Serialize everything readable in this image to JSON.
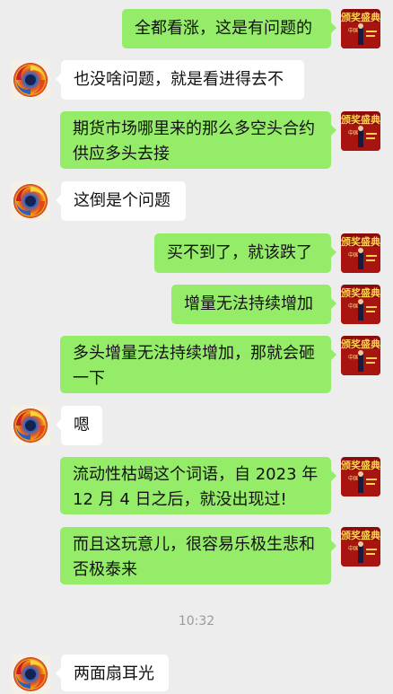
{
  "messages": [
    {
      "text": "全都看涨，这是有问题的"
    },
    {
      "text": "也没啥问题，就是看进得去不"
    },
    {
      "text": "期货市场哪里来的那么多空头合约供应多头去接"
    },
    {
      "text": "这倒是个问题"
    },
    {
      "text": "买不到了，就该跌了"
    },
    {
      "text": "增量无法持续增加"
    },
    {
      "text": "多头增量无法持续增加，那就会砸一下"
    },
    {
      "text": "嗯"
    },
    {
      "text": "流动性枯竭这个词语，自 2023 年 12 月 4 日之后，就没出现过!"
    },
    {
      "text": "而且这玩意儿，很容易乐极生悲和否极泰来"
    },
    {
      "text": "两面扇耳光"
    }
  ],
  "timestamp": "10:32",
  "self_avatar": {
    "banner_text": "颁奖盛典",
    "sub_text": "中国",
    "icon": "award-ceremony-avatar"
  },
  "other_avatar": {
    "icon": "swirl-avatar"
  },
  "colors": {
    "background": "#ededed",
    "self_bubble": "#95ec69",
    "other_bubble": "#ffffff"
  }
}
